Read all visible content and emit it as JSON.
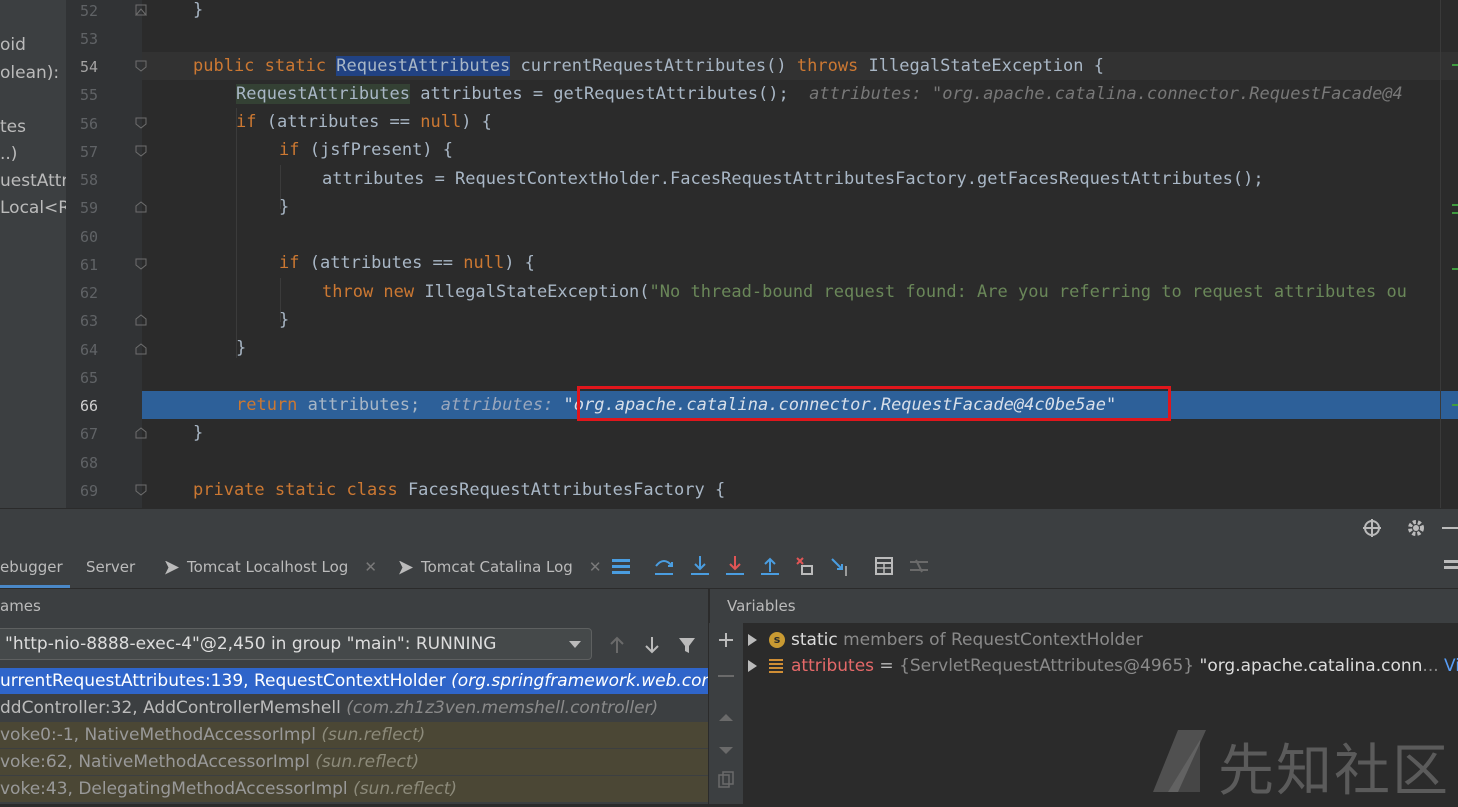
{
  "structure_panel": {
    "items": [
      "oid",
      "olean):",
      "tes",
      "..)",
      "uestAttri",
      "Local<R"
    ]
  },
  "editor": {
    "line_numbers": [
      "52",
      "53",
      "54",
      "55",
      "56",
      "57",
      "58",
      "59",
      "60",
      "61",
      "62",
      "63",
      "64",
      "65",
      "66",
      "67",
      "68",
      "69"
    ],
    "lines": {
      "l52": "}",
      "l54a": "public static ",
      "l54b": "RequestAttributes",
      "l54c": " currentRequestAttributes() ",
      "l54d": "throws",
      "l54e": " IllegalStateException {",
      "l55a": "RequestAttributes",
      "l55b": " attributes = getRequestAttributes();",
      "l55hint": "  attributes: \"org.apache.catalina.connector.RequestFacade@4",
      "l56a": "if",
      "l56b": " (attributes == ",
      "l56c": "null",
      "l56d": ") {",
      "l57a": "if",
      "l57b": " (jsfPresent) {",
      "l58": "attributes = RequestContextHolder.FacesRequestAttributesFactory.getFacesRequestAttributes();",
      "l59": "}",
      "l61a": "if",
      "l61b": " (attributes == ",
      "l61c": "null",
      "l61d": ") {",
      "l62a": "throw new",
      "l62b": " IllegalStateException(",
      "l62c": "\"No thread-bound request found: Are you referring to request attributes ou",
      "l63": "}",
      "l64": "}",
      "l66a": "return",
      "l66b": " attributes;",
      "l66hint": "  attributes: ",
      "l66val": "\"org.apache.catalina.connector.RequestFacade@4c0be5ae\"",
      "l67": "}",
      "l69a": "private static class",
      "l69b": " FacesRequestAttributesFactory {"
    }
  },
  "tabs": [
    {
      "label": "ebugger"
    },
    {
      "label": "Server"
    },
    {
      "label": "Tomcat Localhost Log"
    },
    {
      "label": "Tomcat Catalina Log"
    }
  ],
  "frames": {
    "header": "ames",
    "thread": "\"http-nio-8888-exec-4\"@2,450 in group \"main\": RUNNING",
    "items": [
      {
        "method": "urrentRequestAttributes:139, RequestContextHolder",
        "pkg": "(org.springframework.web.cont"
      },
      {
        "method": "ddController:32, AddControllerMemshell",
        "pkg": "(com.zh1z3ven.memshell.controller)"
      },
      {
        "method": "voke0:-1, NativeMethodAccessorImpl",
        "pkg": "(sun.reflect)"
      },
      {
        "method": "voke:62, NativeMethodAccessorImpl",
        "pkg": "(sun.reflect)"
      },
      {
        "method": "voke:43, DelegatingMethodAccessorImpl",
        "pkg": "(sun.reflect)"
      }
    ]
  },
  "variables": {
    "header": "Variables",
    "items": [
      {
        "name": "static",
        "rest": " members of RequestContextHolder"
      },
      {
        "name": "attributes",
        "eq": " = ",
        "type": "{ServletRequestAttributes@4965}",
        "value": " \"org.apache.catalina.conn",
        "ellipsis": "...",
        "view": " View"
      }
    ]
  },
  "watermark": "先知社区",
  "colors": {
    "editor_bg": "#2b2b2b",
    "keyword": "#cc7832",
    "string": "#6a8759",
    "exec_line": "#2d6099",
    "highlight_box": "#e0161c",
    "selected_frame": "#2f65ca"
  }
}
